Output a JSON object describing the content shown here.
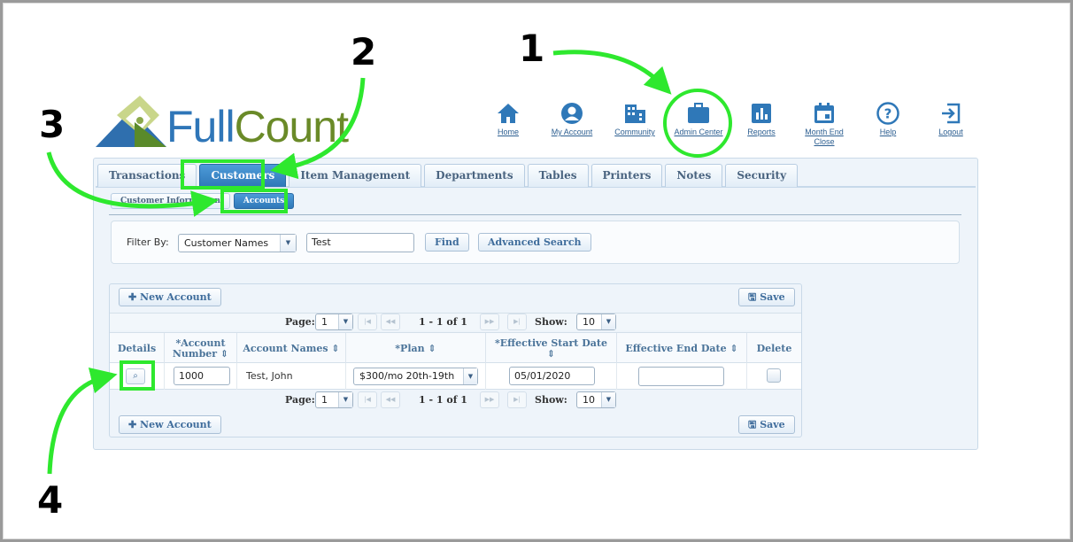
{
  "logo": {
    "part1": "Full",
    "part2": "Count"
  },
  "nav": [
    {
      "label": "Home",
      "icon": "home-icon"
    },
    {
      "label": "My Account",
      "icon": "user-circle-icon"
    },
    {
      "label": "Community",
      "icon": "building-icon"
    },
    {
      "label": "Admin Center",
      "icon": "briefcase-icon"
    },
    {
      "label": "Reports",
      "icon": "bar-chart-icon"
    },
    {
      "label": "Month End",
      "label2": "Close",
      "icon": "calendar-icon"
    },
    {
      "label": "Help",
      "icon": "help-icon"
    },
    {
      "label": "Logout",
      "icon": "logout-icon"
    }
  ],
  "tabs": [
    "Transactions",
    "Customers",
    "Item Management",
    "Departments",
    "Tables",
    "Printers",
    "Notes",
    "Security"
  ],
  "subtabs": [
    "Customer Information",
    "Accounts"
  ],
  "filter": {
    "label": "Filter By:",
    "select_value": "Customer Names",
    "text_value": "Test",
    "find_label": "Find",
    "advanced_label": "Advanced Search"
  },
  "grid": {
    "new_account_label": "New Account",
    "save_label": "Save",
    "pager": {
      "page_label": "Page:",
      "page_value": "1",
      "range": "1 - 1 of 1",
      "show_label": "Show:",
      "show_value": "10"
    },
    "columns": {
      "details": "Details",
      "account_number_1": "*Account",
      "account_number_2": "Number",
      "account_names": "Account Names",
      "plan": "*Plan",
      "effective_start": "*Effective Start Date",
      "effective_end": "Effective End Date",
      "delete": "Delete"
    },
    "row": {
      "account_number": "1000",
      "account_name": "Test, John",
      "plan": "$300/mo 20th-19th",
      "start_date": "05/01/2020",
      "end_date": ""
    }
  },
  "steps": [
    "1",
    "2",
    "3",
    "4"
  ],
  "colors": {
    "highlight": "#2ee82e",
    "accent": "#2f78b8",
    "link": "#2d5f91"
  }
}
